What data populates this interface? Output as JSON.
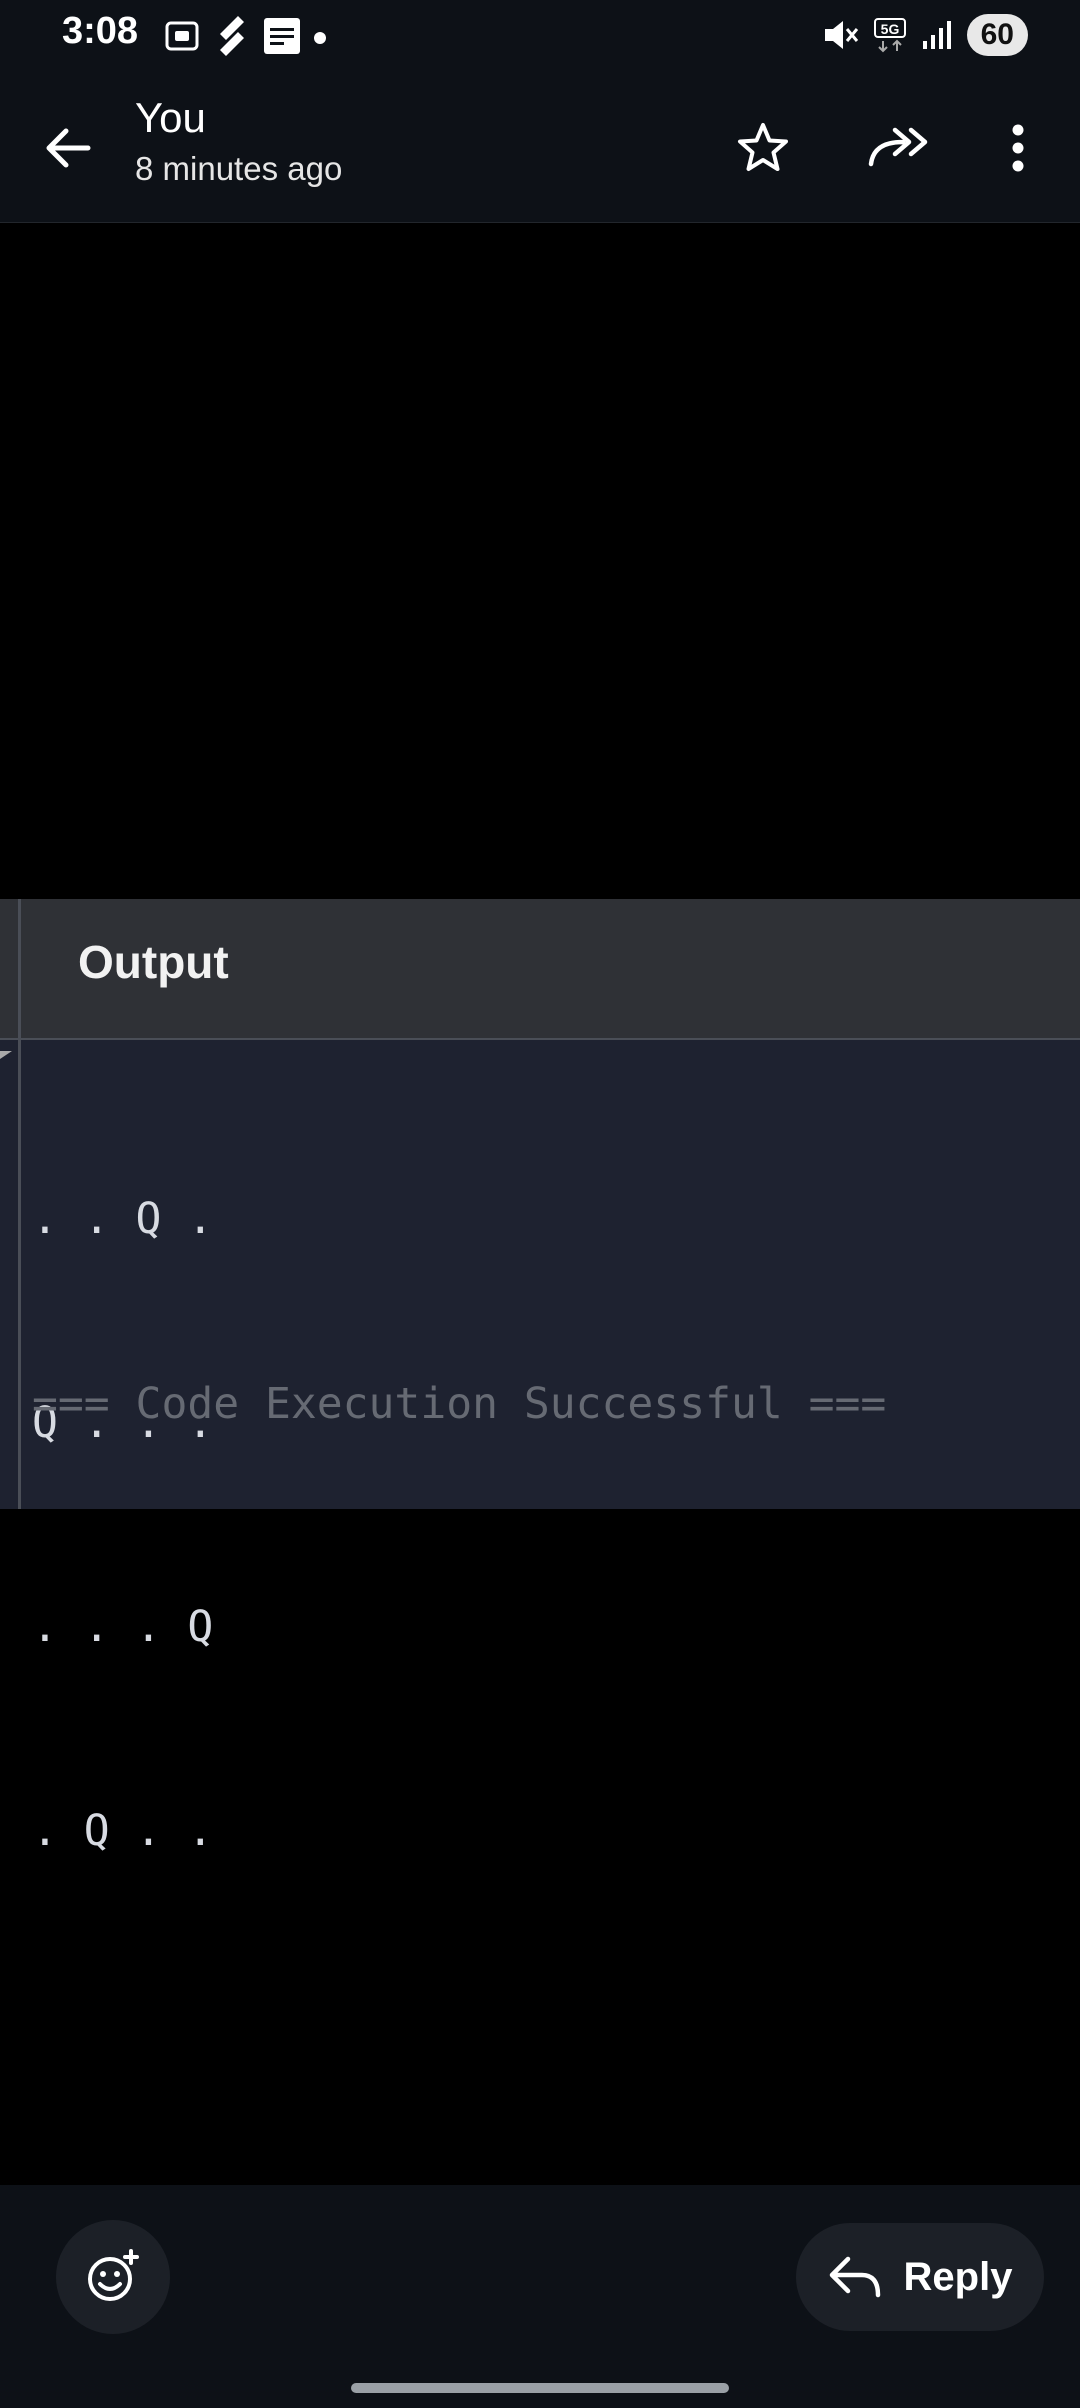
{
  "status_bar": {
    "time": "3:08",
    "battery": "60",
    "network": "5G"
  },
  "header": {
    "sender": "You",
    "timestamp": "8 minutes ago"
  },
  "attachment": {
    "panel_title": "Output",
    "console_lines": [
      ". . Q .",
      "Q . . .",
      ". . . Q",
      ". Q . ."
    ],
    "status_line": "=== Code Execution Successful ==="
  },
  "footer": {
    "reply_label": "Reply"
  },
  "colors": {
    "bar_background": "#0d1117",
    "panel_header": "#2f3136",
    "console_background": "#1e2230"
  }
}
